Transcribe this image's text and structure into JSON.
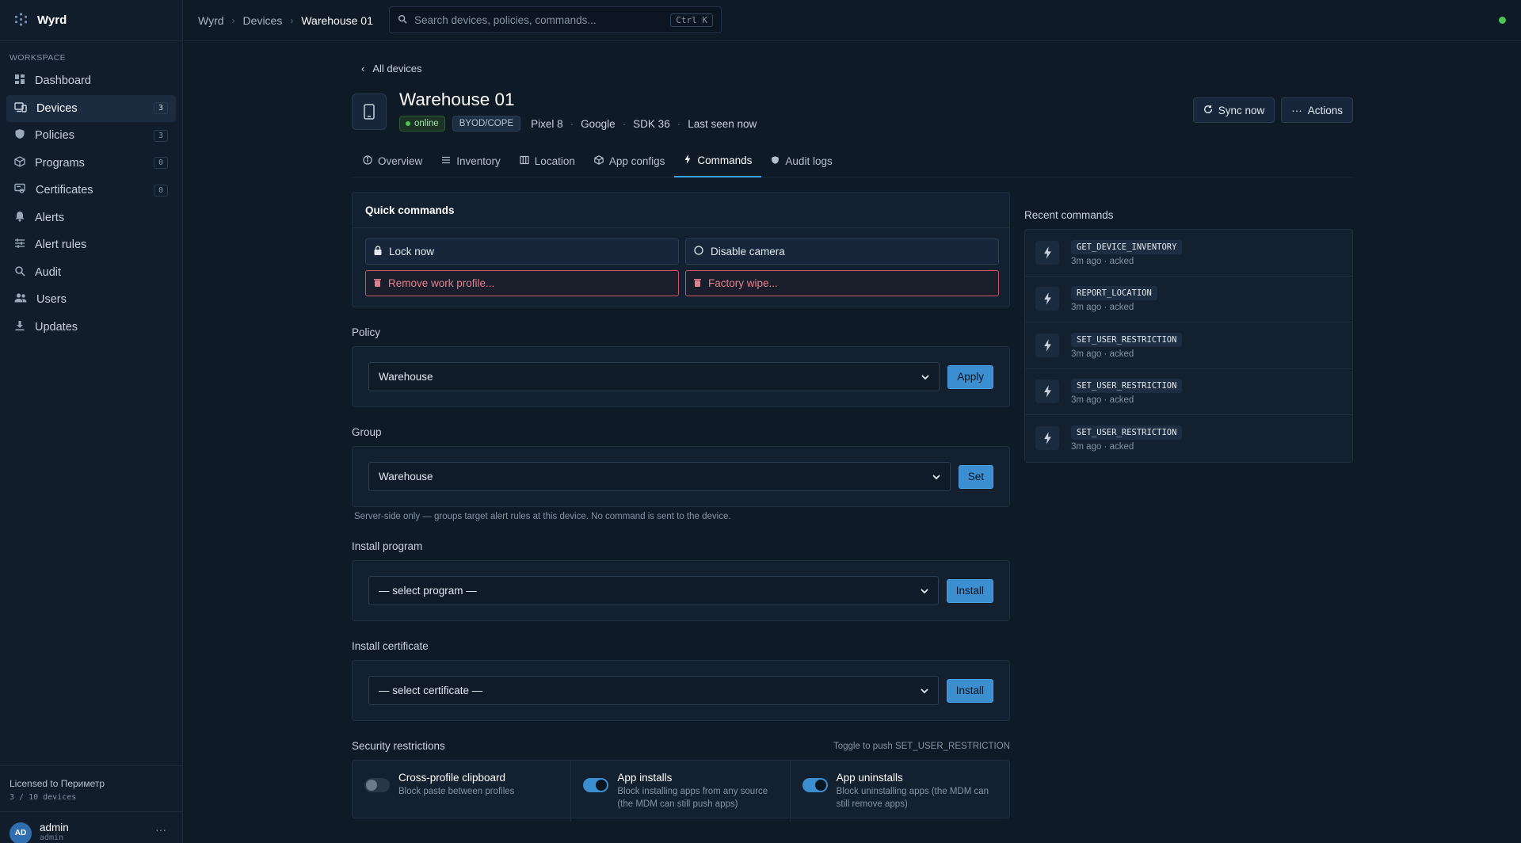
{
  "app": {
    "name": "Wyrd"
  },
  "sidebar": {
    "section_label": "WORKSPACE",
    "items": [
      {
        "label": "Dashboard",
        "icon": "dashboard-icon",
        "count": null,
        "active": false
      },
      {
        "label": "Devices",
        "icon": "devices-icon",
        "count": "3",
        "active": true
      },
      {
        "label": "Policies",
        "icon": "shield-icon",
        "count": "3",
        "active": false
      },
      {
        "label": "Programs",
        "icon": "package-icon",
        "count": "0",
        "active": false
      },
      {
        "label": "Certificates",
        "icon": "certificate-icon",
        "count": "0",
        "active": false
      },
      {
        "label": "Alerts",
        "icon": "bell-icon",
        "count": null,
        "active": false
      },
      {
        "label": "Alert rules",
        "icon": "sliders-icon",
        "count": null,
        "active": false
      },
      {
        "label": "Audit",
        "icon": "search-icon",
        "count": null,
        "active": false
      },
      {
        "label": "Users",
        "icon": "users-icon",
        "count": null,
        "active": false
      },
      {
        "label": "Updates",
        "icon": "download-icon",
        "count": null,
        "active": false
      }
    ],
    "license": {
      "text": "Licensed to Периметр",
      "usage": "3 / 10 devices"
    },
    "user": {
      "initials": "AD",
      "name": "admin",
      "role": "admin"
    }
  },
  "topbar": {
    "breadcrumbs": [
      "Wyrd",
      "Devices",
      "Warehouse 01"
    ],
    "search_placeholder": "Search devices, policies, commands...",
    "shortcut": "Ctrl K"
  },
  "device": {
    "back_label": "All devices",
    "title": "Warehouse 01",
    "status": "online",
    "mode": "BYOD/COPE",
    "model": "Pixel 8",
    "manufacturer": "Google",
    "sdk": "SDK 36",
    "last_seen": "Last seen now",
    "sync_label": "Sync now",
    "actions_label": "Actions"
  },
  "tabs": [
    {
      "label": "Overview",
      "icon": "info-icon",
      "active": false
    },
    {
      "label": "Inventory",
      "icon": "list-icon",
      "active": false
    },
    {
      "label": "Location",
      "icon": "map-icon",
      "active": false
    },
    {
      "label": "App configs",
      "icon": "package-icon",
      "active": false
    },
    {
      "label": "Commands",
      "icon": "bolt-icon",
      "active": true
    },
    {
      "label": "Audit logs",
      "icon": "shield-icon",
      "active": false
    }
  ],
  "quick_commands": {
    "title": "Quick commands",
    "lock": "Lock now",
    "camera": "Disable camera",
    "remove_profile": "Remove work profile...",
    "factory_wipe": "Factory wipe..."
  },
  "policy": {
    "label": "Policy",
    "value": "Warehouse",
    "button": "Apply"
  },
  "group": {
    "label": "Group",
    "value": "Warehouse",
    "button": "Set",
    "hint": "Server-side only — groups target alert rules at this device. No command is sent to the device."
  },
  "install_program": {
    "label": "Install program",
    "value": "— select program —",
    "button": "Install"
  },
  "install_certificate": {
    "label": "Install certificate",
    "value": "— select certificate —",
    "button": "Install"
  },
  "security": {
    "label": "Security restrictions",
    "hint": "Toggle to push SET_USER_RESTRICTION",
    "toggles": [
      {
        "title": "Cross-profile clipboard",
        "desc": "Block paste between profiles",
        "on": false
      },
      {
        "title": "App installs",
        "desc": "Block installing apps from any source (the MDM can still push apps)",
        "on": true
      },
      {
        "title": "App uninstalls",
        "desc": "Block uninstalling apps (the MDM can still remove apps)",
        "on": true
      }
    ]
  },
  "recent_commands": {
    "label": "Recent commands",
    "items": [
      {
        "code": "GET_DEVICE_INVENTORY",
        "meta": "3m ago · acked"
      },
      {
        "code": "REPORT_LOCATION",
        "meta": "3m ago · acked"
      },
      {
        "code": "SET_USER_RESTRICTION",
        "meta": "3m ago · acked"
      },
      {
        "code": "SET_USER_RESTRICTION",
        "meta": "3m ago · acked"
      },
      {
        "code": "SET_USER_RESTRICTION",
        "meta": "3m ago · acked"
      }
    ]
  },
  "colors": {
    "accent": "#3b8fd0",
    "danger": "#e57f8d",
    "online": "#4cc552",
    "background": "#0f1a27"
  }
}
